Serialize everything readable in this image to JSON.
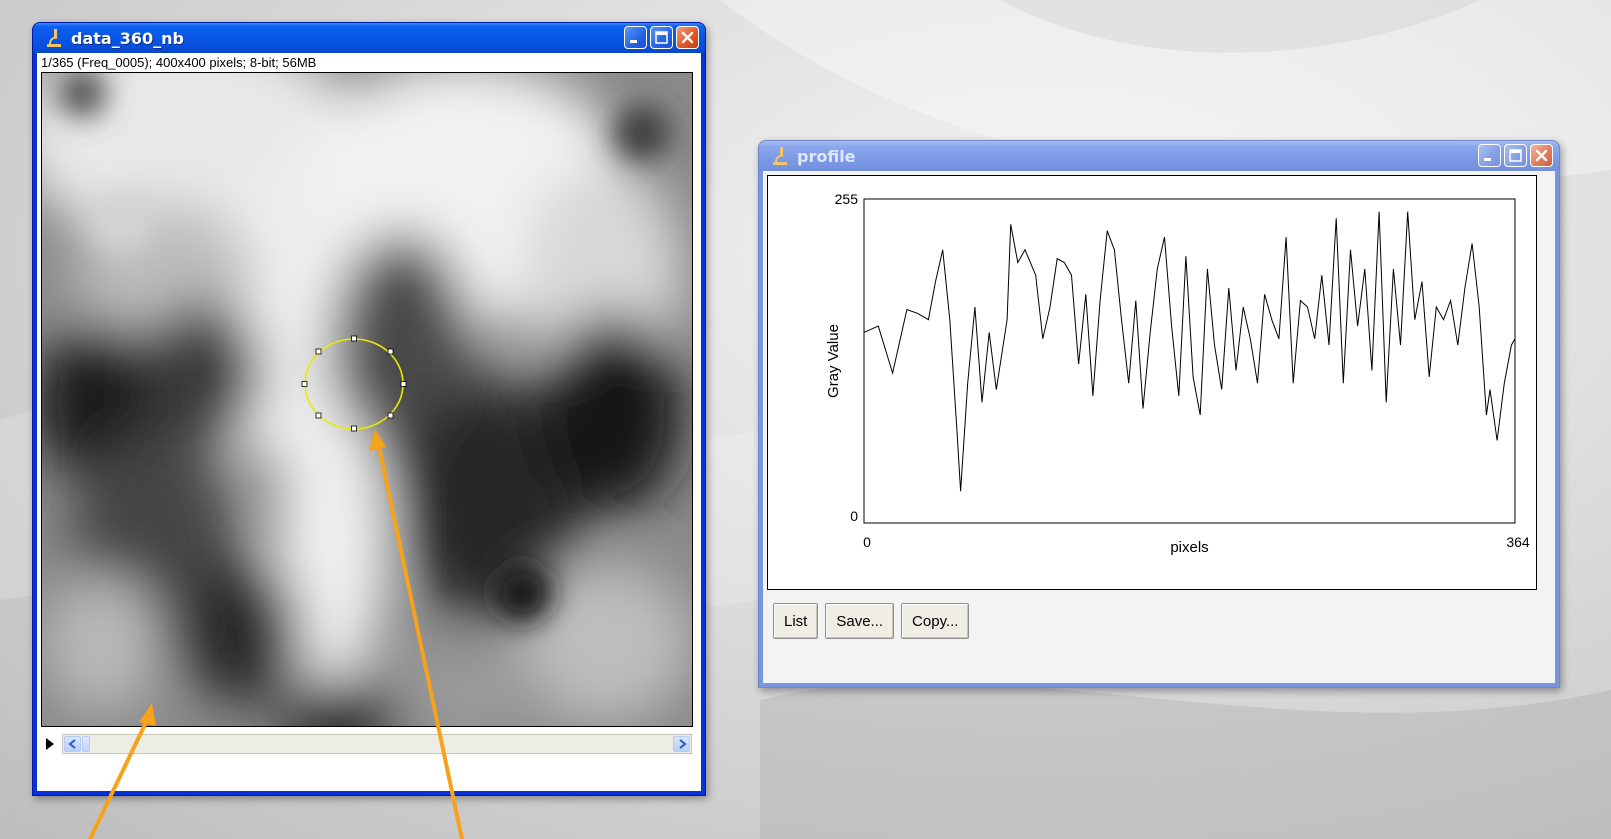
{
  "image_window": {
    "title": "data_360_nb",
    "info_line": "1/365 (Freq_0005); 400x400 pixels; 8-bit; 56MB",
    "selection_shape": "oval"
  },
  "profile_window": {
    "title": "profile",
    "buttons": {
      "list": "List",
      "save": "Save...",
      "copy": "Copy..."
    }
  },
  "chart_data": {
    "type": "line",
    "title": "",
    "xlabel": "pixels",
    "ylabel": "Gray Value",
    "xlim": [
      0,
      364
    ],
    "ylim": [
      0,
      255
    ],
    "x_ticks": [
      "0",
      "364"
    ],
    "y_ticks": [
      "0",
      "255"
    ],
    "grid": false,
    "legend": "none",
    "series": [
      {
        "color": "#000000",
        "points": [
          [
            0,
            150
          ],
          [
            8,
            155
          ],
          [
            16,
            118
          ],
          [
            24,
            168
          ],
          [
            30,
            165
          ],
          [
            36,
            160
          ],
          [
            40,
            190
          ],
          [
            44,
            215
          ],
          [
            48,
            160
          ],
          [
            52,
            72
          ],
          [
            54,
            25
          ],
          [
            58,
            110
          ],
          [
            62,
            170
          ],
          [
            66,
            95
          ],
          [
            70,
            150
          ],
          [
            74,
            105
          ],
          [
            80,
            160
          ],
          [
            82,
            235
          ],
          [
            86,
            205
          ],
          [
            90,
            215
          ],
          [
            96,
            195
          ],
          [
            100,
            145
          ],
          [
            104,
            170
          ],
          [
            108,
            208
          ],
          [
            112,
            205
          ],
          [
            116,
            195
          ],
          [
            120,
            125
          ],
          [
            124,
            180
          ],
          [
            128,
            100
          ],
          [
            132,
            175
          ],
          [
            136,
            230
          ],
          [
            140,
            215
          ],
          [
            144,
            160
          ],
          [
            148,
            110
          ],
          [
            152,
            175
          ],
          [
            156,
            90
          ],
          [
            160,
            150
          ],
          [
            164,
            200
          ],
          [
            168,
            225
          ],
          [
            172,
            155
          ],
          [
            176,
            100
          ],
          [
            180,
            210
          ],
          [
            184,
            115
          ],
          [
            188,
            85
          ],
          [
            192,
            200
          ],
          [
            196,
            140
          ],
          [
            200,
            105
          ],
          [
            204,
            185
          ],
          [
            208,
            120
          ],
          [
            212,
            170
          ],
          [
            216,
            145
          ],
          [
            220,
            110
          ],
          [
            224,
            180
          ],
          [
            228,
            160
          ],
          [
            232,
            145
          ],
          [
            236,
            225
          ],
          [
            240,
            110
          ],
          [
            244,
            175
          ],
          [
            248,
            170
          ],
          [
            252,
            145
          ],
          [
            256,
            195
          ],
          [
            260,
            140
          ],
          [
            264,
            240
          ],
          [
            268,
            110
          ],
          [
            272,
            215
          ],
          [
            276,
            155
          ],
          [
            280,
            200
          ],
          [
            284,
            120
          ],
          [
            288,
            245
          ],
          [
            292,
            95
          ],
          [
            296,
            200
          ],
          [
            300,
            140
          ],
          [
            304,
            245
          ],
          [
            308,
            160
          ],
          [
            312,
            190
          ],
          [
            316,
            115
          ],
          [
            320,
            170
          ],
          [
            324,
            160
          ],
          [
            328,
            175
          ],
          [
            332,
            140
          ],
          [
            336,
            185
          ],
          [
            340,
            220
          ],
          [
            344,
            170
          ],
          [
            348,
            85
          ],
          [
            350,
            105
          ],
          [
            354,
            65
          ],
          [
            358,
            110
          ],
          [
            362,
            140
          ],
          [
            364,
            145
          ]
        ]
      }
    ]
  }
}
